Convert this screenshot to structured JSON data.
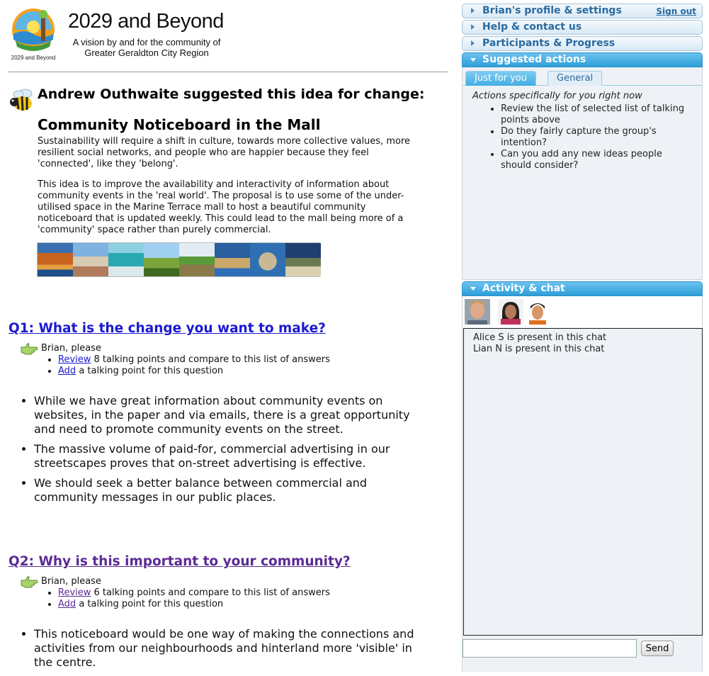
{
  "site": {
    "title": "2029 and Beyond",
    "tagline": "A vision by and for the community of Greater Geraldton City Region",
    "logo_text": "2029 and Beyond"
  },
  "idea": {
    "heading": "Andrew Outhwaite suggested this idea for change:",
    "title": "Community Noticeboard in the Mall",
    "paragraphs": [
      "Sustainability will require a shift in culture, towards more collective values, more resilient social networks, and people who are happier because they feel 'connected', like they 'belong'.",
      "This idea is to improve the availability and interactivity of information about community events in the 'real world'. The proposal is to use some of the under-utilised space in the Marine Terrace mall to host a beautiful community noticeboard that is updated weekly. This could lead to the mall being more of a 'community' space rather than purely commercial."
    ]
  },
  "questions": [
    {
      "heading": "Q1: What is the change you want to make?",
      "prompt_lead": "Brian, please",
      "review_link": "Review",
      "review_rest": "8 talking points and compare to this list of answers",
      "add_link": "Add",
      "add_rest": "a talking point for this question",
      "answers": [
        "While we have great information about community events on websites, in the paper and via emails, there is a great opportunity and need to promote community events on the street.",
        "The massive volume of paid-for, commercial advertising in our streetscapes proves that on-street advertising is effective.",
        "We should seek a better balance between commercial and community messages in our public places."
      ]
    },
    {
      "heading": "Q2: Why is this important to your community?",
      "prompt_lead": "Brian, please",
      "review_link": "Review",
      "review_rest": "6 talking points and compare to this list of answers",
      "add_link": "Add",
      "add_rest": "a talking point for this question",
      "answers": [
        "This noticeboard would be one way of making the connections and activities from our neighbourhoods and hinterland more 'visible' in the centre."
      ]
    }
  ],
  "sidebar": {
    "profile_label": "Brian's profile & settings",
    "signout_label": "Sign out",
    "help_label": "Help & contact us",
    "participants_label": "Participants & Progress",
    "suggested_label": "Suggested actions",
    "tabs": [
      "Just for you",
      "General"
    ],
    "actions_heading": "Actions specifically for you right now",
    "actions": [
      "Review the list of selected list of talking points above",
      "Do they fairly capture the group's intention?",
      "Can you add any new ideas people should consider?"
    ],
    "activity_label": "Activity & chat",
    "chat_messages": [
      "Alice S is present in this chat",
      "Lian N is present in this chat"
    ],
    "chat_placeholder": "",
    "send_label": "Send"
  },
  "colors": {
    "link": "#1a1ad0",
    "visited_link": "#5b2b94",
    "sidebar_bar_active": "#2d9ed8",
    "sidebar_text": "#2a6aa0"
  },
  "icons": [
    "bee-icon",
    "pointing-hand-icon",
    "chevron-right-icon",
    "chevron-down-icon"
  ]
}
